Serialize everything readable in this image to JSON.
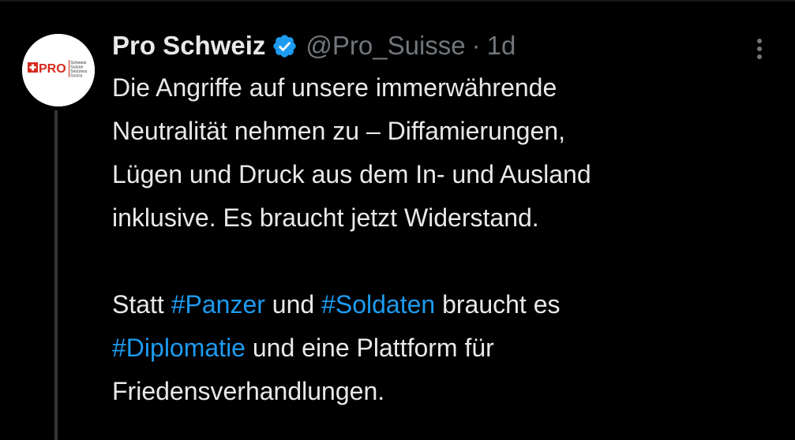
{
  "tweet": {
    "display_name": "Pro Schweiz",
    "handle": "@Pro_Suisse",
    "separator": "·",
    "time": "1d",
    "verified_icon": "verified-badge-icon",
    "avatar": {
      "logo_text": "PRO",
      "logo_lines": [
        "Schweiz",
        "Suisse",
        "Svizzera",
        "Svizra"
      ]
    },
    "paragraph1": [
      "Die Angriffe auf unsere immerwährende",
      "Neutralität nehmen zu – Diffamierungen,",
      "Lügen und Druck aus dem In- und Ausland",
      "inklusive. Es braucht jetzt Widerstand."
    ],
    "paragraph2": {
      "line1": {
        "t1": "Statt ",
        "tag1": "#Panzer",
        "t2": " und ",
        "tag2": "#Soldaten",
        "t3": " braucht es"
      },
      "line2": {
        "tag": "#Diplomatie",
        "t": " und eine Plattform für"
      },
      "line3": "Friedensverhandlungen."
    }
  },
  "colors": {
    "background": "#000000",
    "text": "#e7e9ea",
    "secondary": "#71767b",
    "link": "#1d9bf0",
    "verified": "#1d9bf0",
    "brand_red": "#d52b1e"
  },
  "icons": {
    "more": "more-options-icon"
  }
}
